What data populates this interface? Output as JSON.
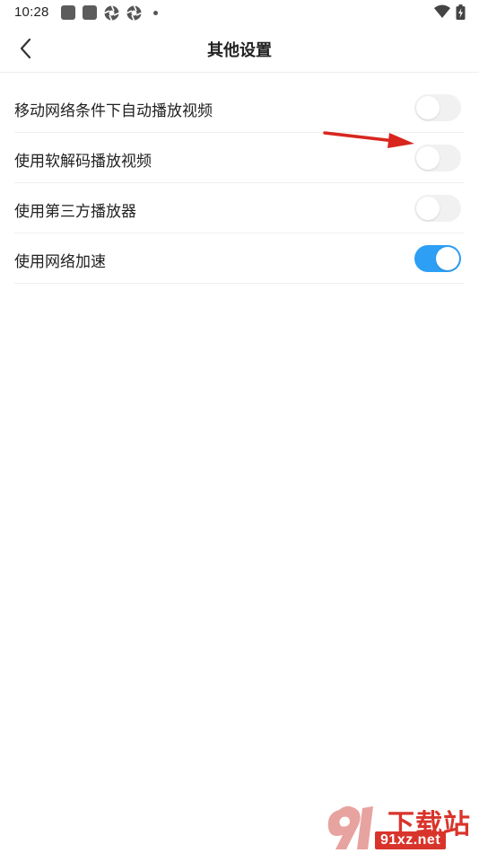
{
  "status_bar": {
    "time": "10:28",
    "left_icons": [
      "notification-square-icon",
      "notification-square-icon",
      "aperture-icon",
      "aperture-icon",
      "dot-icon"
    ],
    "right_icons": [
      "wifi-icon",
      "battery-charging-icon"
    ]
  },
  "header": {
    "title": "其他设置",
    "back_icon": "chevron-left-icon"
  },
  "settings": [
    {
      "label": "移动网络条件下自动播放视频",
      "enabled": false
    },
    {
      "label": "使用软解码播放视频",
      "enabled": false
    },
    {
      "label": "使用第三方播放器",
      "enabled": false
    },
    {
      "label": "使用网络加速",
      "enabled": true
    }
  ],
  "colors": {
    "toggle_on": "#2d9ff5",
    "toggle_off": "#f1f1f1",
    "annotation_arrow": "#d8261f",
    "watermark": "#d9342b"
  },
  "watermark": {
    "brand_text": "下载站",
    "url": "91xz.net"
  }
}
